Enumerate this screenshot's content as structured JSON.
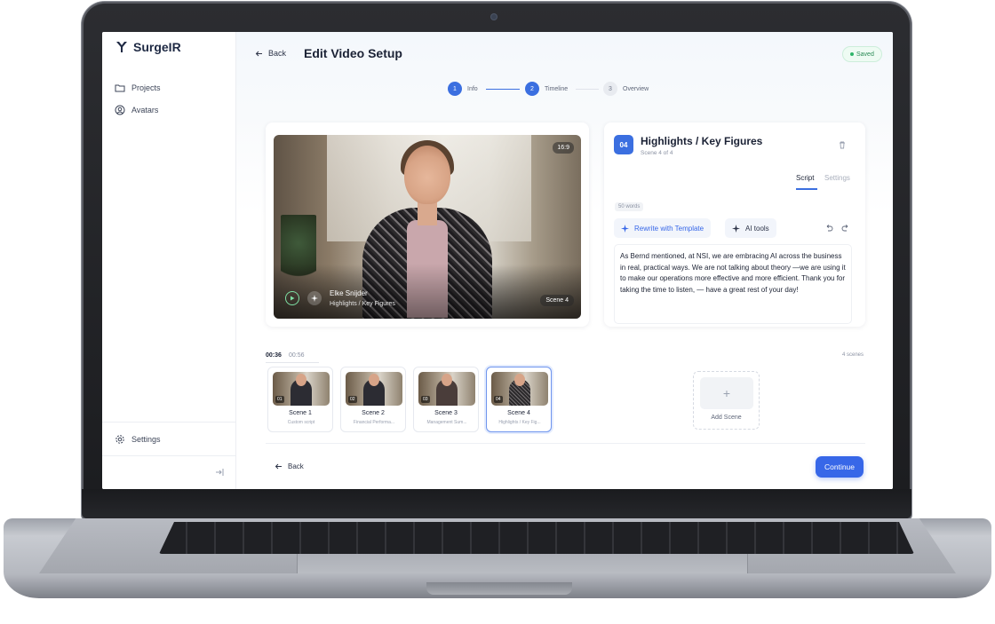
{
  "app": {
    "name": "SurgeIR"
  },
  "sidebar": {
    "items": [
      {
        "label": "Projects"
      },
      {
        "label": "Avatars"
      }
    ],
    "settings_label": "Settings"
  },
  "header": {
    "back_label": "Back",
    "title": "Edit Video Setup",
    "saved_label": "Saved"
  },
  "stepper": {
    "steps": [
      {
        "number": "1",
        "label": "Info",
        "state": "done"
      },
      {
        "number": "2",
        "label": "Timeline",
        "state": "active"
      },
      {
        "number": "3",
        "label": "Overview",
        "state": "pending"
      }
    ]
  },
  "video": {
    "aspect": "16:9",
    "presenter_name": "Elke Snijder",
    "presenter_subtitle": "Highlights / Key Figures",
    "scene_badge": "Scene 4"
  },
  "scene_editor": {
    "number": "04",
    "title": "Highlights / Key Figures",
    "position": "Scene 4 of 4",
    "tabs": [
      {
        "label": "Script",
        "active": true
      },
      {
        "label": "Settings",
        "active": false
      }
    ],
    "word_count": "50 words",
    "rewrite_label": "Rewrite with Template",
    "ai_tools_label": "AI tools",
    "script_text": "As Bernd mentioned, at NSI, we are embracing AI across the business in real, practical ways. We are not talking about theory —we are using it to make our operations more effective and more efficient. Thank you for taking the time to listen, — have a great rest of your day!"
  },
  "timeline": {
    "current_time": "00:36",
    "total_time": "00:56",
    "scene_count_label": "4 scenes",
    "scenes": [
      {
        "num": "01",
        "title": "Scene 1",
        "subtitle": "Custom script",
        "active": false
      },
      {
        "num": "02",
        "title": "Scene 2",
        "subtitle": "Financial Performa...",
        "active": false
      },
      {
        "num": "03",
        "title": "Scene 3",
        "subtitle": "Management Sum...",
        "active": false
      },
      {
        "num": "04",
        "title": "Scene 4",
        "subtitle": "Highlights / Key Fig...",
        "active": true
      }
    ],
    "add_label": "Add Scene"
  },
  "footer": {
    "back_label": "Back",
    "continue_label": "Continue"
  },
  "colors": {
    "accent": "#3767e8",
    "saved_green": "#2fb56a"
  }
}
